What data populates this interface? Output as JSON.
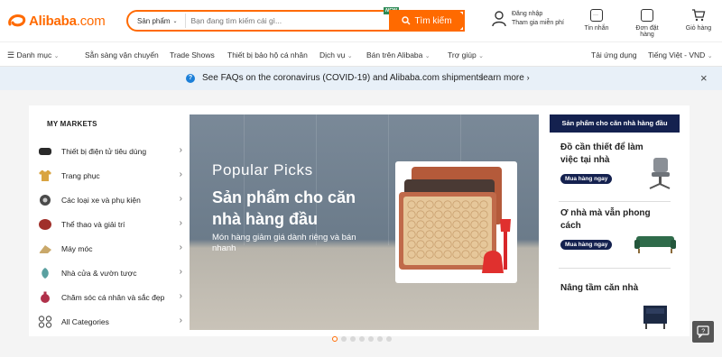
{
  "header": {
    "logo_text": "Alibaba",
    "logo_suffix": ".com",
    "search": {
      "category": "Sản phẩm",
      "placeholder": "Bạn đang tìm kiếm cái gì...",
      "new_badge": "NEW",
      "button_label": "Tìm kiếm"
    },
    "account": {
      "line1": "Đăng nhập",
      "line2": "Tham gia miễn phí"
    },
    "icons": [
      {
        "label": "Tin nhắn",
        "icon": "message-icon"
      },
      {
        "label": "Đơn đặt hàng",
        "icon": "orders-icon"
      },
      {
        "label": "Giỏ hàng",
        "icon": "cart-icon"
      }
    ]
  },
  "nav": {
    "items": [
      "Danh mục",
      "Sẵn sàng vận chuyển",
      "Trade Shows",
      "Thiết bị bảo hộ cá nhân",
      "Dịch vụ",
      "Bán trên Alibaba",
      "Trợ giúp"
    ],
    "right": [
      "Tải ứng dụng",
      "Tiếng Việt - VND"
    ]
  },
  "banner": {
    "message": "See FAQs on the coronavirus (COVID-19) and Alibaba.com shipments",
    "more": "learn more",
    "close": "×"
  },
  "markets": {
    "title": "MY MARKETS",
    "items": [
      {
        "label": "Thiết bị điện tử tiêu dùng",
        "color": "#2a2a2a"
      },
      {
        "label": "Trang phục",
        "color": "#d9a441"
      },
      {
        "label": "Các loại xe và phụ kiện",
        "color": "#4a4a4a"
      },
      {
        "label": "Thể thao và giải trí",
        "color": "#a0302a"
      },
      {
        "label": "Máy móc",
        "color": "#c9a86a"
      },
      {
        "label": "Nhà cửa & vườn tược",
        "color": "#5aa0a0"
      },
      {
        "label": "Chăm sóc cá nhân và sắc đẹp",
        "color": "#b0304a"
      },
      {
        "label": "All Categories",
        "color": "#555555"
      }
    ]
  },
  "hero": {
    "kicker": "Popular Picks",
    "title": "Sản phẩm cho căn nhà hàng đầu",
    "subtitle": "Món hàng giảm giá dành riêng và bán nhanh"
  },
  "right_panel": {
    "header": "Sản phẩm cho căn nhà hàng đầu",
    "cards": [
      {
        "title": "Đồ cần thiết để làm việc tại nhà",
        "button": "Mua hàng ngay"
      },
      {
        "title": "Ơ nhà mà vẫn phong cách",
        "button": "Mua hàng ngay"
      },
      {
        "title": "Nâng tầm căn nhà",
        "button": ""
      }
    ]
  },
  "carousel": {
    "count": 7,
    "active": 0
  },
  "colors": {
    "brand": "#ff6a00",
    "navy": "#14214f",
    "banner_bg": "#e8f0f8"
  }
}
